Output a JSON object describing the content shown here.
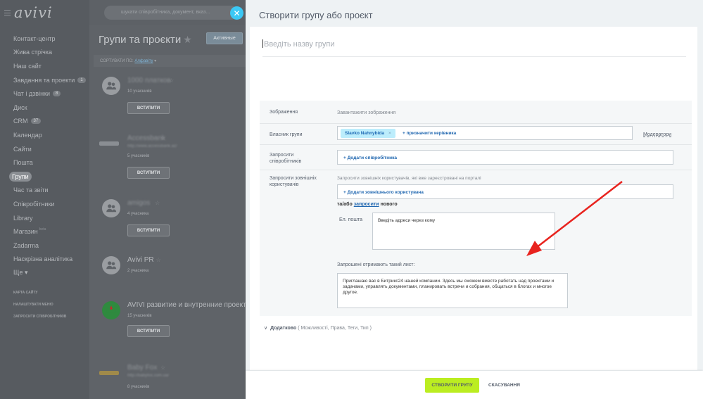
{
  "app": {
    "logo": "avivi"
  },
  "search": {
    "placeholder": "шукати співробітника, документ, вказ..."
  },
  "sidebar": {
    "items": [
      {
        "label": "Контакт-центр"
      },
      {
        "label": "Жива стрічка"
      },
      {
        "label": "Наш сайт"
      },
      {
        "label": "Завдання та проекти",
        "count": "1"
      },
      {
        "label": "Чат і дзвінки",
        "count": "8"
      },
      {
        "label": "Диск"
      },
      {
        "label": "CRM",
        "count": "37"
      },
      {
        "label": "Календар"
      },
      {
        "label": "Сайти"
      },
      {
        "label": "Пошта"
      },
      {
        "label": "Групи",
        "active": true
      },
      {
        "label": "Час та звіти"
      },
      {
        "label": "Співробітники"
      },
      {
        "label": "Library"
      },
      {
        "label": "Магазин",
        "sup": "beta"
      },
      {
        "label": "Zadarma"
      },
      {
        "label": "Наскрізна аналітика"
      },
      {
        "label": "Ще ▾"
      }
    ],
    "links": [
      "КАРТА САЙТУ",
      "НАЛАШТУВАТИ МЕНЮ",
      "ЗАПРОСИТИ СПІВРОБІТНИКІВ"
    ]
  },
  "main": {
    "title": "Групи та проєкти",
    "filter_button": "Активные",
    "sort_label": "СОРТУВАТИ ПО:",
    "sort_value": "Алфавіту",
    "join_label": "ВСТУПИТИ",
    "groups": [
      {
        "name": "1000 платков",
        "count": "10 учасників"
      },
      {
        "name": "Accessbank",
        "url": "http://www.accessbank.az/",
        "count": "5 учасників"
      },
      {
        "name": "amigos",
        "count": "4 учасника"
      },
      {
        "name": "Avivi PR",
        "count": "2 учасника"
      },
      {
        "name": "AVIVI развитие и внутренние проекты",
        "count": "15 учасників"
      },
      {
        "name": "Baby Fox",
        "url": "http://babyfox.com.ua/",
        "count": "8 учасників"
      }
    ]
  },
  "panel": {
    "title": "Створити групу або проєкт",
    "name_placeholder": "Введіть назву групи",
    "image_label": "Зображення",
    "image_upload": "Завантажити зображення",
    "owner_label": "Власник групи",
    "owner_name": "Slavko Nahnybida",
    "assign_head": "+ призначити керівника",
    "moderators": "Модератори",
    "invite_employees_label": "Запросити співробітників",
    "add_employee": "+ Додати співробітника",
    "invite_external_label": "Запросити зовнішніх користувачів",
    "external_hint": "Запросити зовнішніх користувачів, які вже зареєстровані на порталі",
    "add_external": "+ Додати зовнішнього користувача",
    "or_invite_prefix": "та/або ",
    "or_invite_link": "запросити",
    "or_invite_suffix": " нового",
    "email_label": "Ел. пошта",
    "email_placeholder": "Введіть адреси через кому",
    "letter_label": "Запрошені отримають такий лист:",
    "letter_text": "Приглашаю вас в Битрикс24 нашей компании. Здесь мы сможем вместе работать над проектами и задачами, управлять документами, планировать встречи и собрания, общаться в блогах и многое другое.",
    "more_label": "Додатково",
    "more_sub": "( Можливості,  Права,  Теги,  Тип  )",
    "create_button": "СТВОРИТИ ГРУПУ",
    "cancel_button": "СКАСУВАННЯ"
  },
  "colors": {
    "accent_green": "#bbed21",
    "chip_blue": "#bcedfc",
    "link_blue": "#2067b0",
    "arrow_red": "#e8231e"
  }
}
